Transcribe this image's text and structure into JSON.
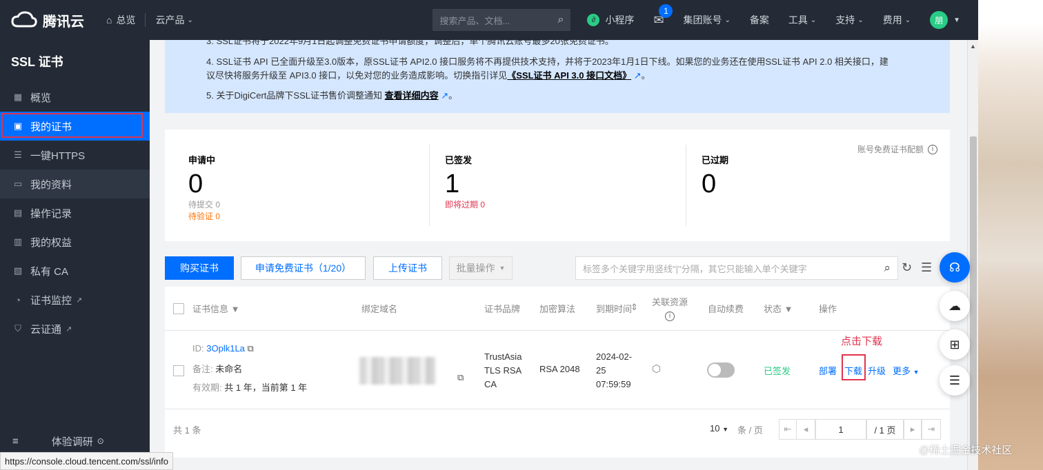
{
  "topbar": {
    "brand": "腾讯云",
    "overview": "总览",
    "products": "云产品",
    "search_placeholder": "搜索产品、文档...",
    "miniprogram": "小程序",
    "mail_badge": "1",
    "group_account": "集团账号",
    "beian": "备案",
    "tools": "工具",
    "support": "支持",
    "fees": "费用",
    "avatar_text": "朋"
  },
  "sidebar": {
    "title": "SSL 证书",
    "items": [
      {
        "label": "概览",
        "icon": "grid-icon"
      },
      {
        "label": "我的证书",
        "icon": "certificate-icon"
      },
      {
        "label": "一键HTTPS",
        "icon": "sliders-icon"
      },
      {
        "label": "我的资料",
        "icon": "folder-icon"
      },
      {
        "label": "操作记录",
        "icon": "list-icon"
      },
      {
        "label": "我的权益",
        "icon": "gift-icon"
      },
      {
        "label": "私有 CA",
        "icon": "ca-icon"
      },
      {
        "label": "证书监控",
        "icon": "monitor-icon"
      },
      {
        "label": "云证通",
        "icon": "shield-icon"
      }
    ],
    "bottom": "体验调研"
  },
  "notice": {
    "line3": "3. SSL证书将于2022年9月1日起调整免费证书申请额度，调整后，单个腾讯云账号最多20张免费证书。",
    "line4a": "4. SSL证书 API 已全面升级至3.0版本，原SSL证书 API2.0 接口服务将不再提供技术支持，并将于2023年1月1日下线。如果您的业务还在使用SSL证书 API 2.0 相关接口，建议尽快将服务升级至 API3.0 接口，以免对您的业务造成影响。切换指引详见",
    "line4_link": "《SSL证书 API 3.0 接口文档》",
    "line5a": "5. 关于DigiCert品牌下SSL证书售价调整通知",
    "line5_link": "查看详细内容",
    "period": "。"
  },
  "stats": {
    "applying": {
      "label": "申请中",
      "value": "0",
      "sub1": "待提交 0",
      "sub2": "待验证 0"
    },
    "issued": {
      "label": "已签发",
      "value": "1",
      "sub1": "即将过期 0"
    },
    "expired": {
      "label": "已过期",
      "value": "0"
    },
    "quota_label": "账号免费证书配额"
  },
  "toolbar": {
    "buy": "购买证书",
    "apply_free": "申请免费证书（1/20）",
    "upload": "上传证书",
    "batch": "批量操作",
    "search_placeholder": "标签多个关键字用竖线\"|\"分隔，其它只能输入单个关键字"
  },
  "table": {
    "headers": {
      "cert_info": "证书信息",
      "domain": "绑定域名",
      "brand": "证书品牌",
      "algo": "加密算法",
      "expire": "到期时间",
      "resources": "关联资源",
      "auto_renew": "自动续费",
      "status": "状态",
      "ops": "操作"
    },
    "row": {
      "id_label": "ID:",
      "id": "3Oplk1La",
      "note_label": "备注:",
      "note": "未命名",
      "validity_label": "有效期:",
      "validity": "共 1 年，当前第 1 年",
      "brand_l1": "TrustAsia",
      "brand_l2": "TLS RSA",
      "brand_l3": "CA",
      "algo": "RSA 2048",
      "expire_l1": "2024-02-",
      "expire_l2": "25",
      "expire_l3": "07:59:59",
      "status": "已签发",
      "op_deploy": "部署",
      "op_download": "下载",
      "op_upgrade": "升级",
      "op_more": "更多"
    },
    "annotation": "点击下载",
    "total": "共 1 条",
    "page_size": "10",
    "per_page": "条 / 页",
    "page_current": "1",
    "page_total": "/ 1 页"
  },
  "statusbar": "https://console.cloud.tencent.com/ssl/info",
  "watermark": "@稀土掘金技术社区",
  "colors": {
    "accent": "#006eff",
    "dark": "#242b36",
    "success": "#29cc85",
    "warning": "#ff7200",
    "danger": "#e0334c"
  }
}
